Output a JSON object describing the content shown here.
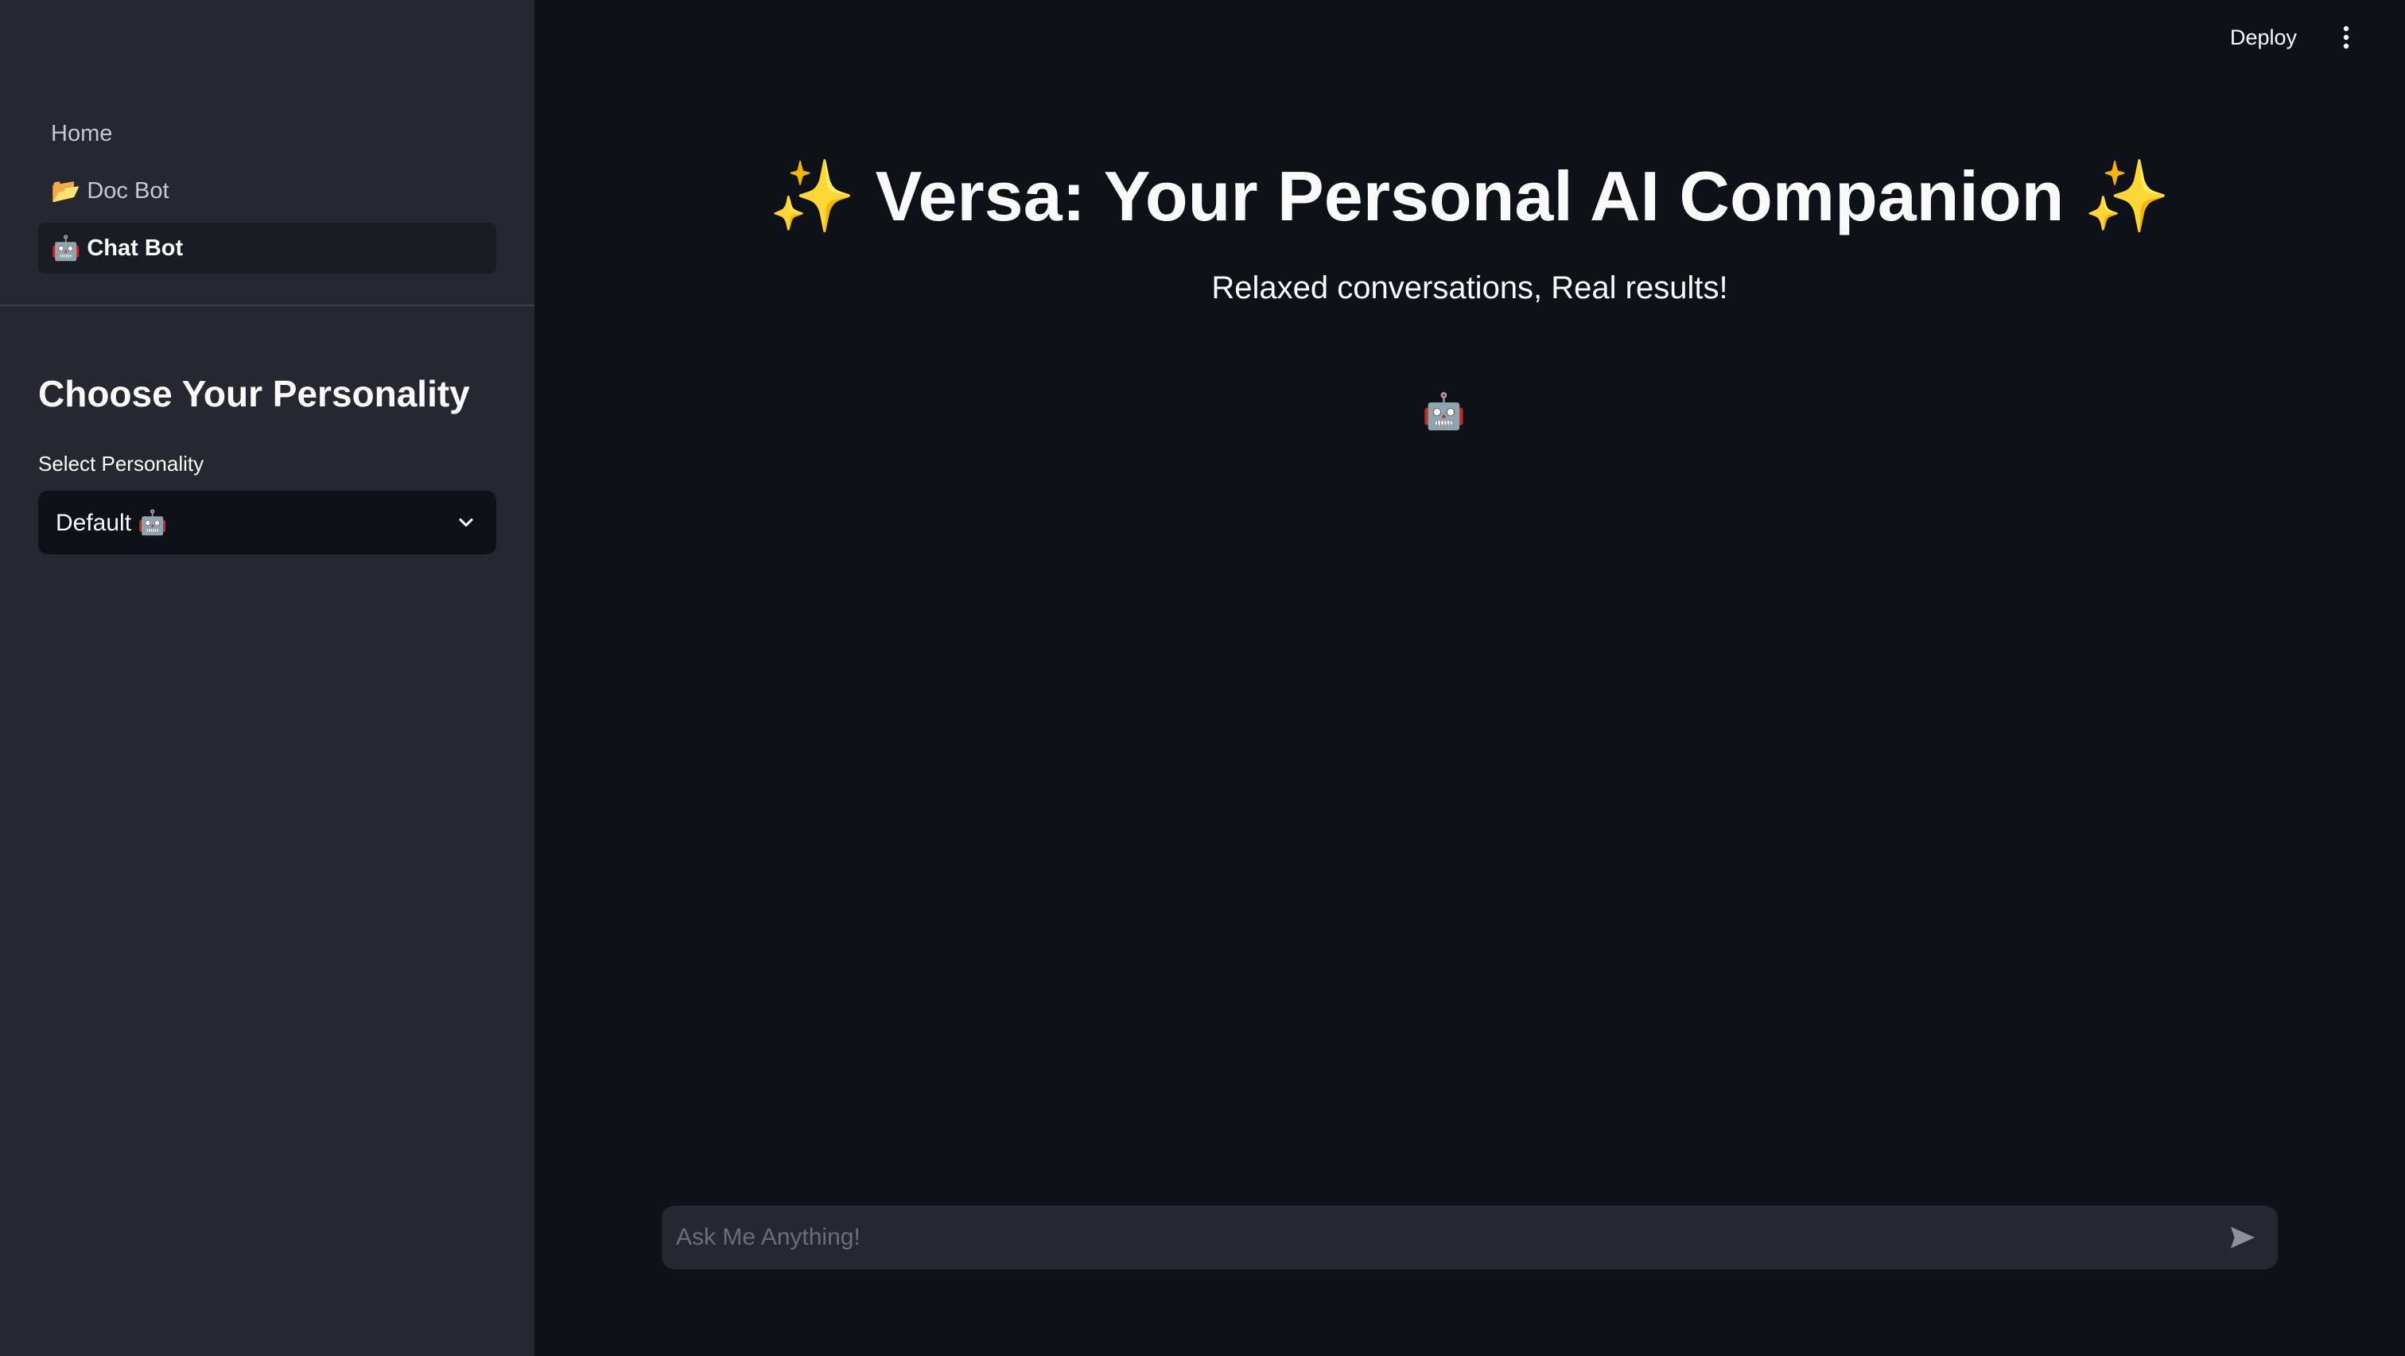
{
  "sidebar": {
    "nav": [
      {
        "label": "Home",
        "icon": ""
      },
      {
        "label": "Doc Bot",
        "icon": "📂"
      },
      {
        "label": "Chat Bot",
        "icon": "🤖"
      }
    ],
    "heading": "Choose Your Personality",
    "select": {
      "label": "Select Personality",
      "value": "Default 🤖"
    }
  },
  "header": {
    "deploy_label": "Deploy",
    "menu_icon": "vertical-dots-icon"
  },
  "main": {
    "title": "✨ Versa: Your Personal AI Companion ✨",
    "subtitle": "Relaxed conversations, Real results!",
    "avatar": "🤖"
  },
  "chat": {
    "placeholder": "Ask Me Anything!",
    "value": "",
    "send_icon": "send-icon"
  },
  "colors": {
    "sidebar_bg": "#262730",
    "main_bg": "#0e1117",
    "text": "#fafafa",
    "active_nav_bg": "#1a1c24"
  }
}
